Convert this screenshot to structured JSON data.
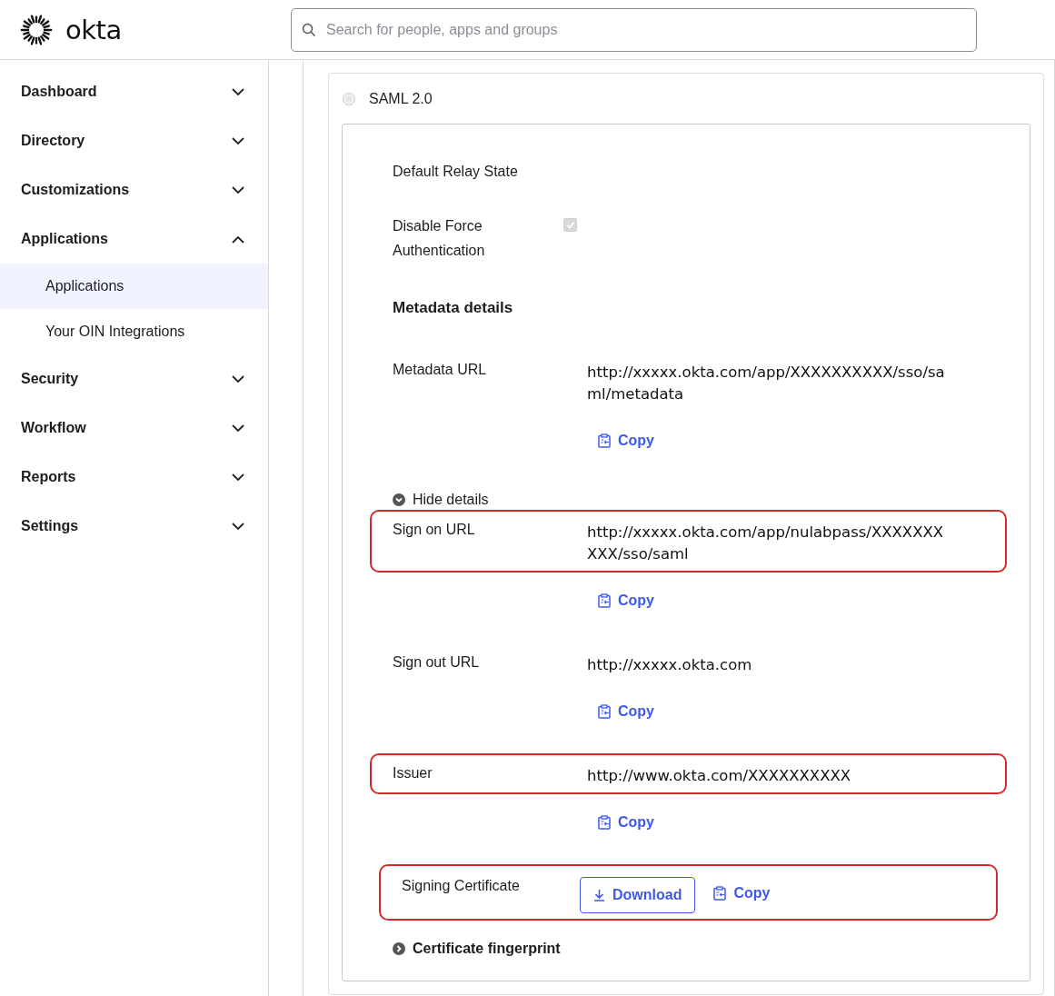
{
  "header": {
    "logo_text": "okta",
    "search": {
      "placeholder": "Search for people, apps and groups"
    }
  },
  "sidebar": {
    "items": [
      {
        "label": "Dashboard",
        "expanded": false
      },
      {
        "label": "Directory",
        "expanded": false
      },
      {
        "label": "Customizations",
        "expanded": false
      },
      {
        "label": "Applications",
        "expanded": true,
        "children": [
          {
            "label": "Applications",
            "selected": true
          },
          {
            "label": "Your OIN Integrations",
            "selected": false
          }
        ]
      },
      {
        "label": "Security",
        "expanded": false
      },
      {
        "label": "Workflow",
        "expanded": false
      },
      {
        "label": "Reports",
        "expanded": false
      },
      {
        "label": "Settings",
        "expanded": false
      }
    ]
  },
  "saml": {
    "option_label": "SAML 2.0",
    "option_selected": false,
    "rows": [
      {
        "kind": "field",
        "label": "Default Relay State"
      },
      {
        "kind": "checkbox",
        "label": "Disable Force Authentication",
        "checked": true,
        "disabled": true
      },
      {
        "kind": "heading",
        "label": "Metadata details"
      },
      {
        "kind": "field",
        "label": "Metadata URL",
        "value": "http://xxxxx.okta.com/app/XXXXXXXXXX/sso/saml/metadata",
        "copy": "Copy"
      },
      {
        "kind": "toggle",
        "label": "Hide details",
        "expanded": true
      },
      {
        "kind": "field",
        "label": "Sign on URL",
        "value": "http://xxxxx.okta.com/app/nulabpass/XXXXXXXXXX/sso/saml",
        "copy": "Copy",
        "highlighted": true
      },
      {
        "kind": "field",
        "label": "Sign out URL",
        "value": "http://xxxxx.okta.com",
        "copy": "Copy"
      },
      {
        "kind": "field",
        "label": "Issuer",
        "value": "http://www.okta.com/XXXXXXXXXX",
        "copy": "Copy",
        "highlighted": true
      },
      {
        "kind": "certificate",
        "label": "Signing Certificate",
        "download": "Download",
        "copy": "Copy",
        "highlighted": true
      },
      {
        "kind": "toggle",
        "label": "Certificate fingerprint",
        "expanded": false
      }
    ]
  }
}
